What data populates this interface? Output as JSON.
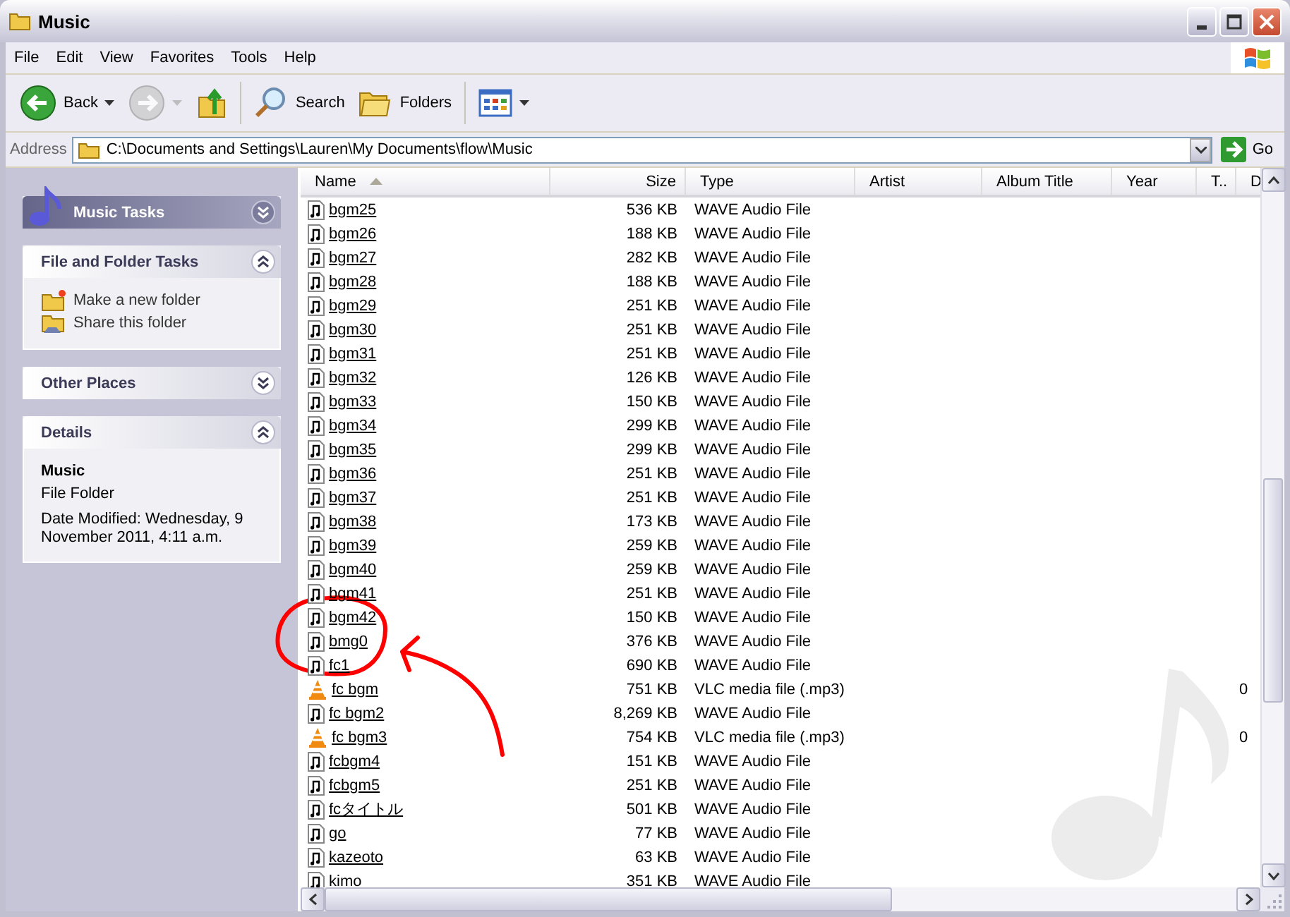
{
  "window": {
    "title": "Music"
  },
  "menu": [
    {
      "label": "File"
    },
    {
      "label": "Edit"
    },
    {
      "label": "View"
    },
    {
      "label": "Favorites"
    },
    {
      "label": "Tools"
    },
    {
      "label": "Help"
    }
  ],
  "toolbar": [
    {
      "kind": "back",
      "label": "Back",
      "disabled": false
    },
    {
      "kind": "forward",
      "disabled": true
    },
    {
      "kind": "up",
      "disabled": false
    },
    {
      "kind": "search",
      "label": "Search",
      "disabled": false
    },
    {
      "kind": "folders",
      "label": "Folders",
      "disabled": false
    },
    {
      "kind": "views",
      "disabled": false
    }
  ],
  "address": {
    "label": "Address",
    "value": "C:\\Documents and Settings\\Lauren\\My Documents\\flow\\Music",
    "go": "Go"
  },
  "task_pane": [
    {
      "kind": "special",
      "title": "Music Tasks",
      "expanded": false
    },
    {
      "kind": "tasks",
      "title": "File and Folder Tasks",
      "expanded": true,
      "items": [
        {
          "kind": "new_folder",
          "label": "Make a new folder"
        },
        {
          "kind": "share",
          "label": "Share this folder"
        }
      ]
    },
    {
      "kind": "tasks",
      "title": "Other Places",
      "expanded": false
    },
    {
      "kind": "details",
      "title": "Details",
      "expanded": true,
      "name": "Music",
      "type": "File Folder",
      "modified": "Date Modified: Wednesday, 9 November 2011, 4:11 a.m."
    }
  ],
  "file_list": {
    "columns": [
      {
        "label": "Name",
        "sorted": true
      },
      {
        "label": "Size",
        "sorted": false
      },
      {
        "label": "Type",
        "sorted": false
      },
      {
        "label": "Artist",
        "sorted": false
      },
      {
        "label": "Album Title",
        "sorted": false
      },
      {
        "label": "Year",
        "sorted": false
      },
      {
        "label": "T..",
        "sorted": false
      },
      {
        "label": "D",
        "sorted": false
      }
    ],
    "rows": [
      {
        "kind": "wave",
        "name": "bgm25",
        "size": "536 KB",
        "type": "WAVE Audio File"
      },
      {
        "kind": "wave",
        "name": "bgm26",
        "size": "188 KB",
        "type": "WAVE Audio File"
      },
      {
        "kind": "wave",
        "name": "bgm27",
        "size": "282 KB",
        "type": "WAVE Audio File"
      },
      {
        "kind": "wave",
        "name": "bgm28",
        "size": "188 KB",
        "type": "WAVE Audio File"
      },
      {
        "kind": "wave",
        "name": "bgm29",
        "size": "251 KB",
        "type": "WAVE Audio File"
      },
      {
        "kind": "wave",
        "name": "bgm30",
        "size": "251 KB",
        "type": "WAVE Audio File"
      },
      {
        "kind": "wave",
        "name": "bgm31",
        "size": "251 KB",
        "type": "WAVE Audio File"
      },
      {
        "kind": "wave",
        "name": "bgm32",
        "size": "126 KB",
        "type": "WAVE Audio File"
      },
      {
        "kind": "wave",
        "name": "bgm33",
        "size": "150 KB",
        "type": "WAVE Audio File"
      },
      {
        "kind": "wave",
        "name": "bgm34",
        "size": "299 KB",
        "type": "WAVE Audio File"
      },
      {
        "kind": "wave",
        "name": "bgm35",
        "size": "299 KB",
        "type": "WAVE Audio File"
      },
      {
        "kind": "wave",
        "name": "bgm36",
        "size": "251 KB",
        "type": "WAVE Audio File"
      },
      {
        "kind": "wave",
        "name": "bgm37",
        "size": "251 KB",
        "type": "WAVE Audio File"
      },
      {
        "kind": "wave",
        "name": "bgm38",
        "size": "173 KB",
        "type": "WAVE Audio File"
      },
      {
        "kind": "wave",
        "name": "bgm39",
        "size": "259 KB",
        "type": "WAVE Audio File"
      },
      {
        "kind": "wave",
        "name": "bgm40",
        "size": "259 KB",
        "type": "WAVE Audio File"
      },
      {
        "kind": "wave",
        "name": "bgm41",
        "size": "251 KB",
        "type": "WAVE Audio File"
      },
      {
        "kind": "wave",
        "name": "bgm42",
        "size": "150 KB",
        "type": "WAVE Audio File"
      },
      {
        "kind": "wave",
        "name": "bmg0",
        "size": "376 KB",
        "type": "WAVE Audio File"
      },
      {
        "kind": "wave",
        "name": "fc1",
        "size": "690 KB",
        "type": "WAVE Audio File"
      },
      {
        "kind": "vlc",
        "name": "fc bgm",
        "size": "751 KB",
        "type": "VLC media file (.mp3)",
        "column_8": "0"
      },
      {
        "kind": "wave",
        "name": "fc bgm2",
        "size": "8,269 KB",
        "type": "WAVE Audio File"
      },
      {
        "kind": "vlc",
        "name": "fc bgm3",
        "size": "754 KB",
        "type": "VLC media file (.mp3)",
        "column_8": "0"
      },
      {
        "kind": "wave",
        "name": "fcbgm4",
        "size": "151 KB",
        "type": "WAVE Audio File"
      },
      {
        "kind": "wave",
        "name": "fcbgm5",
        "size": "251 KB",
        "type": "WAVE Audio File"
      },
      {
        "kind": "wave",
        "name": "fcタイトル",
        "size": "501 KB",
        "type": "WAVE Audio File"
      },
      {
        "kind": "wave",
        "name": "go",
        "size": "77 KB",
        "type": "WAVE Audio File"
      },
      {
        "kind": "wave",
        "name": "kazeoto",
        "size": "63 KB",
        "type": "WAVE Audio File"
      },
      {
        "kind": "wave",
        "name": "kimo",
        "size": "351 KB",
        "type": "WAVE Audio File"
      }
    ]
  }
}
